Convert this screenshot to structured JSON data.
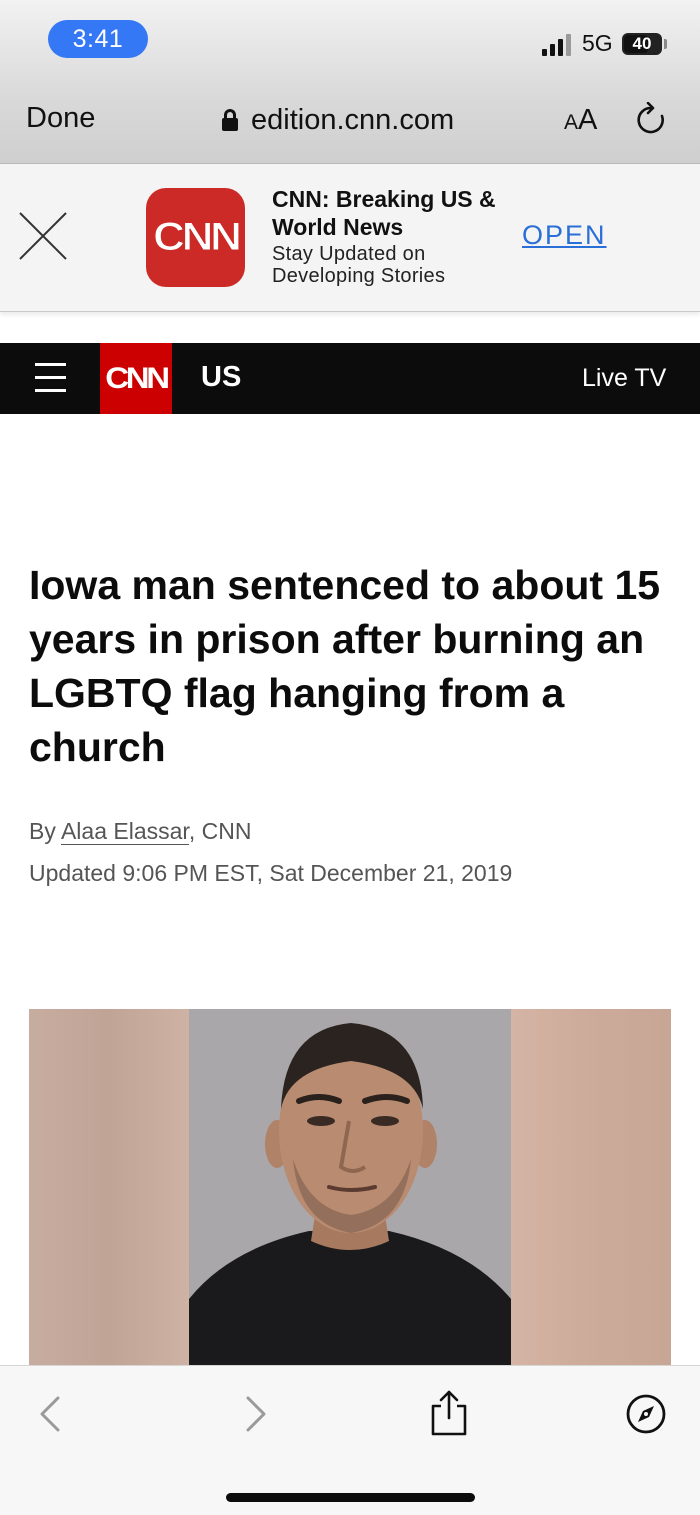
{
  "status_bar": {
    "time": "3:41",
    "network": "5G",
    "battery": "40",
    "accent_color": "#3478f6"
  },
  "browser": {
    "done_label": "Done",
    "url": "edition.cnn.com",
    "text_size_small": "A",
    "text_size_big": "A"
  },
  "app_banner": {
    "logo_text": "CNN",
    "title": "CNN: Breaking US & World News",
    "subtitle": "Stay Updated on Developing Stories",
    "open_label": "OPEN",
    "brand_color": "#cc0000"
  },
  "site_nav": {
    "logo_text": "CNN",
    "section": "US",
    "live_tv": "Live TV"
  },
  "article": {
    "headline": "Iowa man sentenced to about 15 years in prison after burning an LGBTQ flag hanging from a church",
    "byline_prefix": "By ",
    "author": "Alaa Elassar",
    "byline_suffix": ", CNN",
    "updated": "Updated 9:06 PM EST, Sat December 21, 2019"
  },
  "toolbar": {
    "back_icon": "chevron-left-icon",
    "forward_icon": "chevron-right-icon",
    "share_icon": "share-icon",
    "compass_icon": "compass-icon"
  }
}
